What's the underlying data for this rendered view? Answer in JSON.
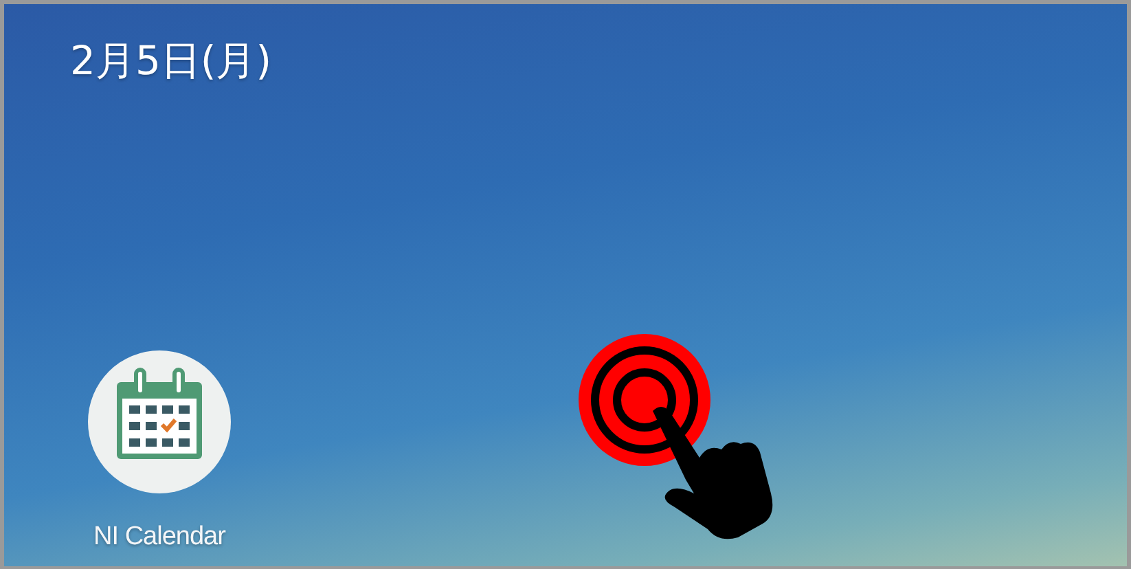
{
  "status": {
    "date": "2月5日(月)"
  },
  "apps": [
    {
      "label": "NI Calendar"
    }
  ]
}
